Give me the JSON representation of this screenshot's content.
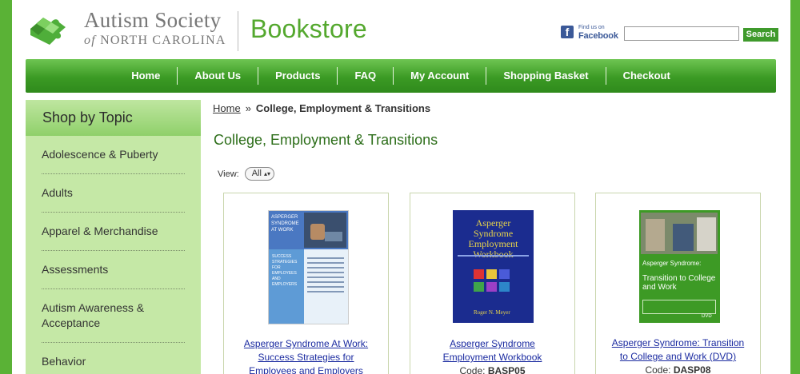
{
  "header": {
    "org_line1": "Autism Society",
    "org_of": "of",
    "org_line2": "NORTH CAROLINA",
    "store_title": "Bookstore",
    "fb_small": "Find us on",
    "fb_big": "Facebook",
    "search_value": "",
    "search_button": "Search"
  },
  "nav": [
    "Home",
    "About Us",
    "Products",
    "FAQ",
    "My Account",
    "Shopping Basket",
    "Checkout"
  ],
  "sidebar": {
    "title": "Shop by Topic",
    "items": [
      "Adolescence & Puberty",
      "Adults",
      "Apparel & Merchandise",
      "Assessments",
      "Autism Awareness & Acceptance",
      "Behavior"
    ]
  },
  "breadcrumb": {
    "home": "Home",
    "separator": "»",
    "current": "College, Employment & Transitions"
  },
  "page_title": "College, Employment & Transitions",
  "view": {
    "label": "View:",
    "selected": "All"
  },
  "products": [
    {
      "title": "Asperger Syndrome At Work: Success Strategies for Employees and Employers",
      "title_lines": [
        "Asperger Syndrome At Work:",
        "Success Strategies for",
        "Employees and Employers"
      ],
      "code_label": "",
      "code": "",
      "cover_text": "ASPERGER SYNDROME AT WORK",
      "cover_sub": "SUCCESS STRATEGIES FOR EMPLOYEES AND EMPLOYERS"
    },
    {
      "title": "Asperger Syndrome Employment Workbook",
      "title_lines": [
        "Asperger Syndrome",
        "Employment Workbook"
      ],
      "code_label": "Code:",
      "code": "BASP05",
      "cover_text": "Asperger Syndrome Employment Workbook",
      "cover_author": "Roger N. Meyer"
    },
    {
      "title": "Asperger Syndrome: Transition to College and Work (DVD)",
      "title_lines": [
        "Asperger Syndrome: Transition",
        "to College and Work (DVD)"
      ],
      "code_label": "Code:",
      "code": "DASP08",
      "cover_text": "Asperger Syndrome:",
      "cover_sub": "Transition to College and Work",
      "cover_dvd": "DVD"
    }
  ],
  "colors": {
    "brand_green": "#54a82e",
    "nav_green": "#3b9a24",
    "sidebar_bg": "#c5e8a6",
    "link_blue": "#1a2aa0",
    "title_green": "#2d6e1a"
  }
}
